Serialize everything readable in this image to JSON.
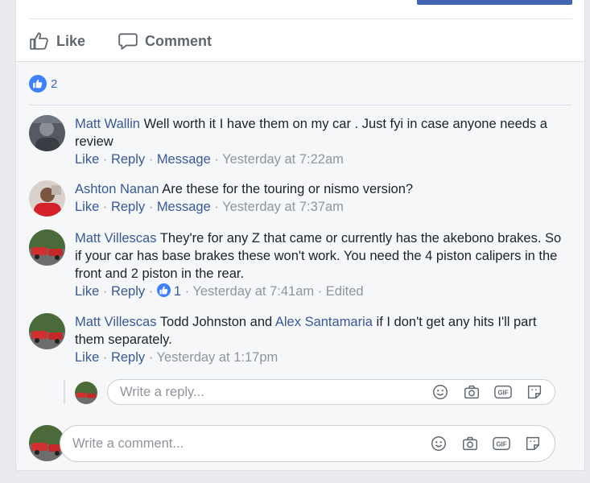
{
  "actions": {
    "like_label": "Like",
    "comment_label": "Comment"
  },
  "reactions": {
    "count": "2"
  },
  "comments": [
    {
      "author": "Matt Wallin",
      "text": " Well worth it I have them on my car . Just fyi in case anyone needs a review",
      "like": "Like",
      "reply": "Reply",
      "message": "Message",
      "time": "Yesterday at 7:22am"
    },
    {
      "author": "Ashton Nanan",
      "text": " Are these for the touring or nismo version?",
      "like": "Like",
      "reply": "Reply",
      "message": "Message",
      "time": "Yesterday at 7:37am"
    },
    {
      "author": "Matt Villescas",
      "text": " They're for any Z that came or currently has the akebono brakes. So if your car has base brakes these won't work. You need the 4 piston calipers in the front and 2 piston in the rear.",
      "like": "Like",
      "reply": "Reply",
      "likes": "1",
      "time": "Yesterday at 7:41am",
      "edited": "Edited"
    },
    {
      "author": "Matt Villescas",
      "text_a": " Todd Johnston and ",
      "mention": "Alex Santamaria",
      "text_b": " if I don't get any hits I'll part them separately.",
      "like": "Like",
      "reply": "Reply",
      "time": "Yesterday at 1:17pm"
    }
  ],
  "reply_box": {
    "placeholder": "Write a reply..."
  },
  "comment_box": {
    "placeholder": "Write a comment..."
  },
  "icons": [
    "like-icon",
    "comment-icon",
    "emoji-icon",
    "camera-icon",
    "gif-icon",
    "sticker-icon"
  ],
  "colors": {
    "link": "#385898",
    "brand": "#4267b2",
    "like_blue": "#4080ff",
    "meta": "#90949c"
  }
}
